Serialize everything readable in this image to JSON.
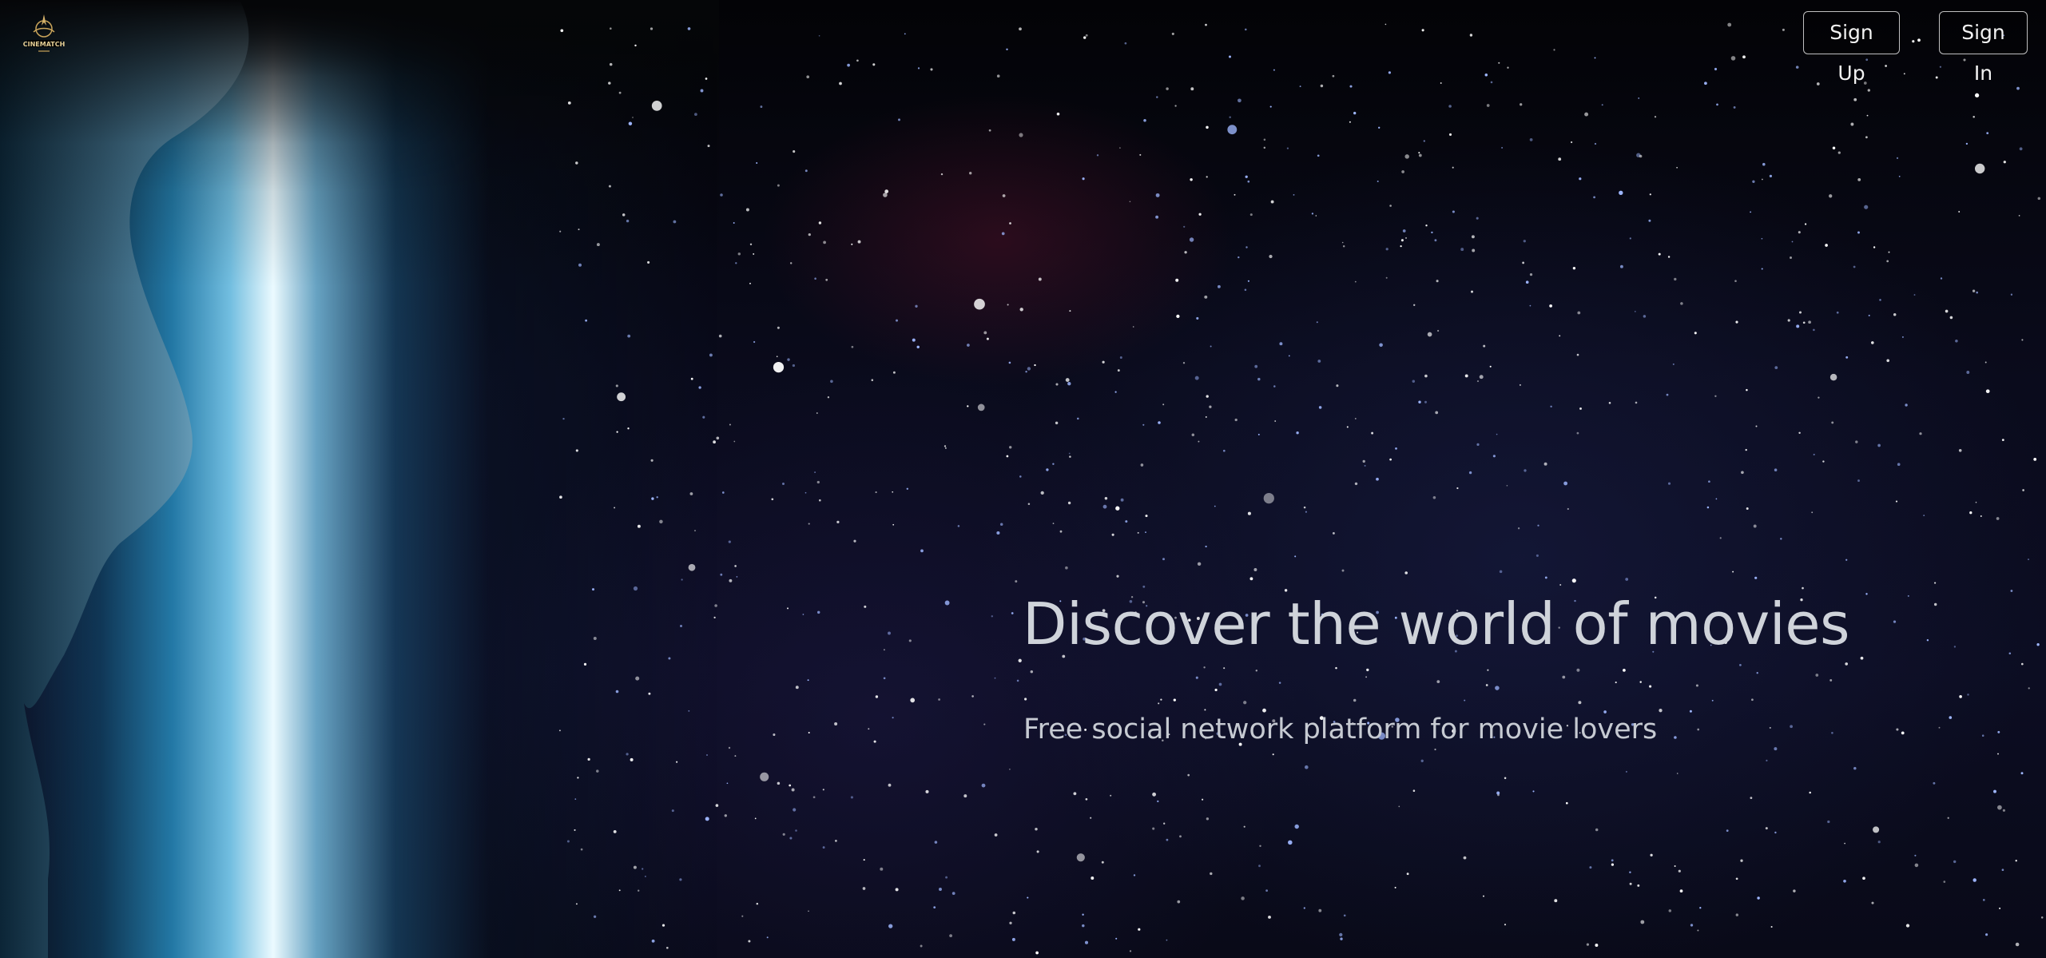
{
  "header": {
    "logo_text": "CINEMATCH",
    "signup_label": "Sign Up",
    "signin_label": "Sign In"
  },
  "hero": {
    "title": "Discover the world of movies",
    "subtitle": "Free social network platform for movie lovers"
  },
  "colors": {
    "accent_gold": "#c9a45a",
    "portal_glow": "#e9f8ff",
    "text": "#cfd3da"
  },
  "icons": {
    "logo": "cinematch-logo-icon"
  }
}
